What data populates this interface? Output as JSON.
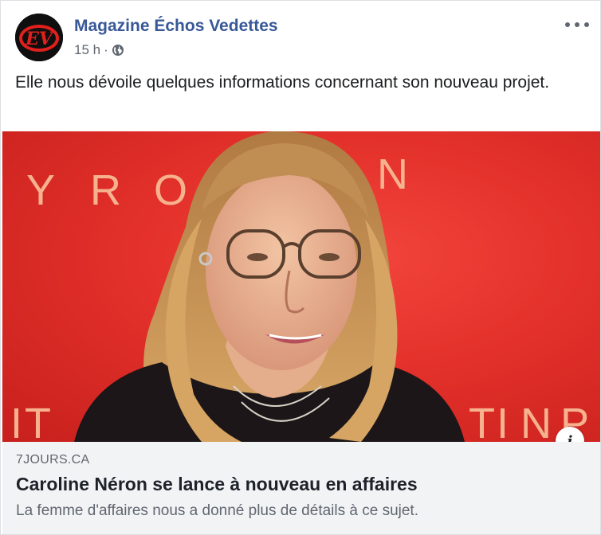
{
  "post": {
    "page_name": "Magazine Échos Vedettes",
    "timestamp": "15 h",
    "separator": "·",
    "audience_icon": "globe-icon",
    "more_icon": "more-options-icon",
    "text": "Elle nous dévoile quelques informations concernant son nouveau projet."
  },
  "avatar": {
    "logo_text": "EV",
    "colors": {
      "background": "#0f0f0f",
      "logo": "#e0201c"
    }
  },
  "link_preview": {
    "domain": "7JOURS.CA",
    "title": "Caroline Néron se lance à nouveau en affaires",
    "description": "La femme d'affaires nous a donné plus de détails à ce sujet.",
    "info_label": "i",
    "photo_backdrop_letters": [
      "Y",
      "R",
      "O",
      "N",
      "I",
      "T",
      "T",
      "I",
      "N",
      "P"
    ]
  },
  "colors": {
    "page_name": "#385898",
    "meta_text": "#606770",
    "footer_bg": "#f2f3f5",
    "photo_bg": "#e3302a"
  }
}
